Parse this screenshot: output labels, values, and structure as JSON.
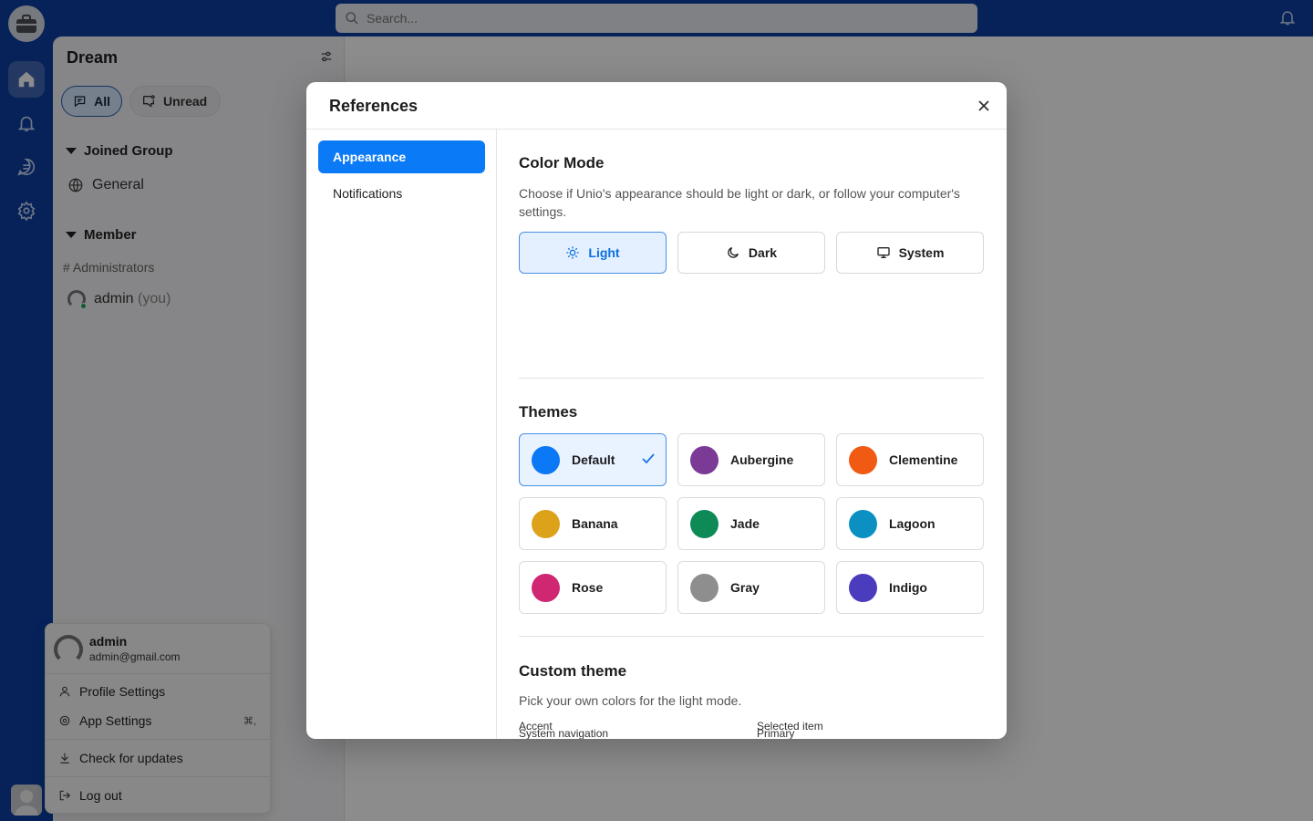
{
  "topbar": {
    "search_placeholder": "Search..."
  },
  "sidebar": {
    "workspace_title": "Dream",
    "chips": [
      {
        "label": "All"
      },
      {
        "label": "Unread"
      }
    ],
    "groups": [
      {
        "label": "Joined Group",
        "items": [
          {
            "label": "General"
          }
        ]
      },
      {
        "label": "Member",
        "sub_label": "# Administrators",
        "items": [
          {
            "name": "admin",
            "suffix": "(you)"
          }
        ]
      }
    ]
  },
  "user_menu": {
    "name": "admin",
    "email": "admin@gmail.com",
    "items": [
      {
        "label": "Profile Settings"
      },
      {
        "label": "App Settings",
        "shortcut": "⌘,"
      },
      {
        "label": "Check for updates"
      },
      {
        "label": "Log out"
      }
    ]
  },
  "modal": {
    "title": "References",
    "nav": [
      {
        "label": "Appearance",
        "active": true
      },
      {
        "label": "Notifications",
        "active": false
      }
    ],
    "color_mode": {
      "title": "Color Mode",
      "description": "Choose if Unio's appearance should be light or dark, or follow your computer's settings.",
      "options": [
        {
          "label": "Light",
          "icon": "sun-icon",
          "selected": true
        },
        {
          "label": "Dark",
          "icon": "moon-icon",
          "selected": false
        },
        {
          "label": "System",
          "icon": "monitor-icon",
          "selected": false
        }
      ]
    },
    "themes": {
      "title": "Themes",
      "items": [
        {
          "label": "Default",
          "color": "#0b78f5",
          "selected": true
        },
        {
          "label": "Aubergine",
          "color": "#7b3a96",
          "selected": false
        },
        {
          "label": "Clementine",
          "color": "#f05a12",
          "selected": false
        },
        {
          "label": "Banana",
          "color": "#dca21a",
          "selected": false
        },
        {
          "label": "Jade",
          "color": "#0e8a57",
          "selected": false
        },
        {
          "label": "Lagoon",
          "color": "#0b90c1",
          "selected": false
        },
        {
          "label": "Rose",
          "color": "#cf2771",
          "selected": false
        },
        {
          "label": "Gray",
          "color": "#8e8e8e",
          "selected": false
        },
        {
          "label": "Indigo",
          "color": "#4a3cbd",
          "selected": false
        }
      ]
    },
    "custom_theme": {
      "title": "Custom theme",
      "description": "Pick your own colors for the light mode.",
      "fields": [
        {
          "label": "System navigation",
          "value": "#0055E3",
          "color": "#0055E3"
        },
        {
          "label": "Primary",
          "value": "#0078F6",
          "color": "#0078F6"
        },
        {
          "label": "Accent"
        },
        {
          "label": "Selected item"
        }
      ]
    }
  },
  "colors": {
    "nav_blue": "#0b3ea3",
    "accent": "#0b7af6"
  }
}
